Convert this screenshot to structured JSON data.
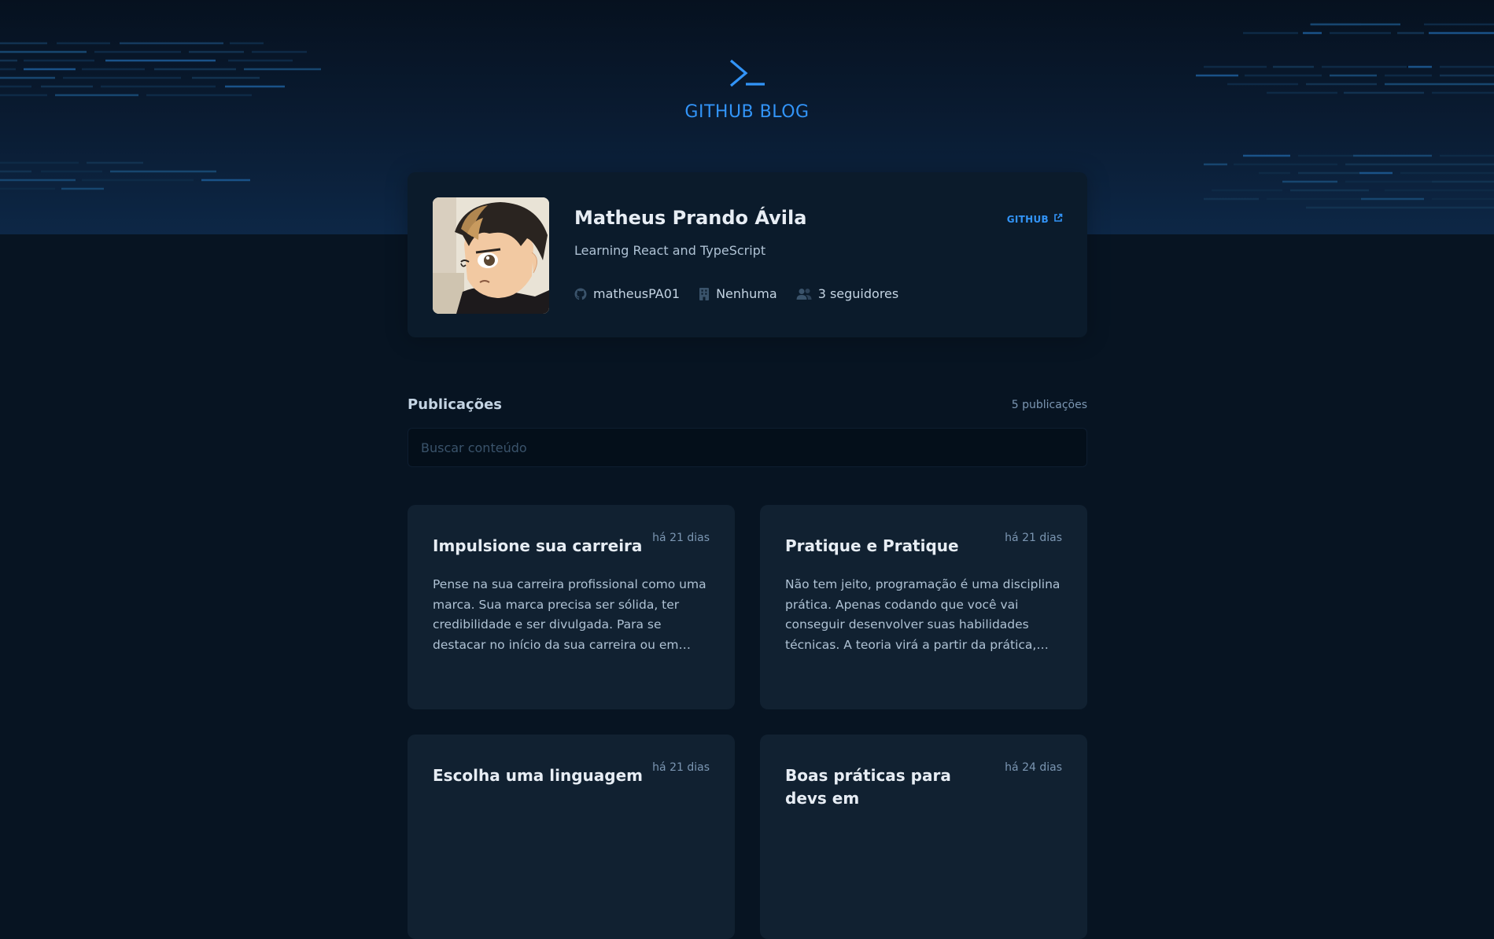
{
  "header": {
    "brand": "GITHUB BLOG",
    "brand_color": "#3294f8",
    "logo_icon": "terminal-prompt-icon"
  },
  "profile": {
    "name": "Matheus Prando Ávila",
    "bio": "Learning React and TypeScript",
    "github_link": "GITHUB",
    "github_link_icon": "external-link-icon",
    "username": "matheusPA01",
    "company": "Nenhuma",
    "followers": "3 seguidores",
    "avatar": "anime-character-avatar"
  },
  "publications": {
    "title": "Publicações",
    "count": "5 publicações",
    "search_placeholder": "Buscar conteúdo",
    "posts": [
      {
        "title": "Impulsione sua carreira",
        "date": "há 21 dias",
        "excerpt": "Pense na sua carreira profissional como uma marca. Sua marca precisa ser sólida, ter credibilidade e ser divulgada. Para se destacar no início da sua carreira ou em qualquer outra fase, é preciso investir em conhecimento e networking."
      },
      {
        "title": "Pratique e Pratique",
        "date": "há 21 dias",
        "excerpt": "Não tem jeito, programação é uma disciplina prática. Apenas codando que você vai conseguir desenvolver suas habilidades técnicas. A teoria virá a partir da prática, não ao contrário. Pratica todos os dias, mesmo que pouco."
      },
      {
        "title": "Escolha uma linguagem",
        "date": "há 21 dias",
        "excerpt": ""
      },
      {
        "title": "Boas práticas para devs em",
        "date": "há 24 dias",
        "excerpt": ""
      }
    ]
  }
}
